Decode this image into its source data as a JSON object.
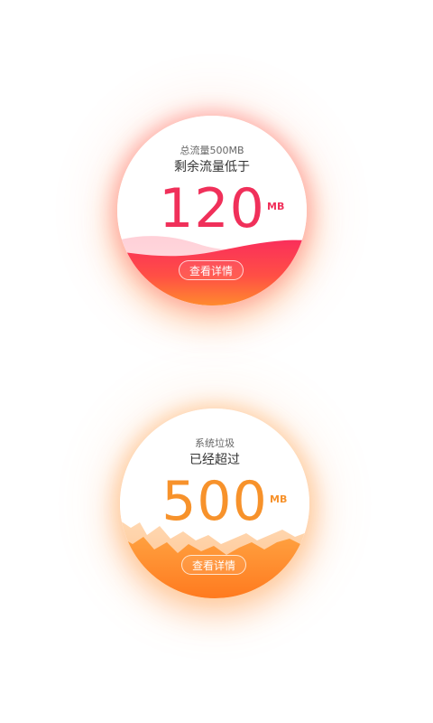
{
  "widgets": [
    {
      "subtitle": "总流量500MB",
      "title": "剩余流量低于",
      "value": "120",
      "unit": "MB",
      "button_label": "查看详情",
      "value_color": "#f0305a",
      "fill_colors": [
        "#fa2f5b",
        "#ff8a2e"
      ]
    },
    {
      "subtitle": "系统垃圾",
      "title": "已经超过",
      "value": "500",
      "unit": "MB",
      "button_label": "查看详情",
      "value_color": "#f7922b",
      "fill_colors": [
        "#ff9a3a",
        "#ff7a1f"
      ]
    }
  ]
}
